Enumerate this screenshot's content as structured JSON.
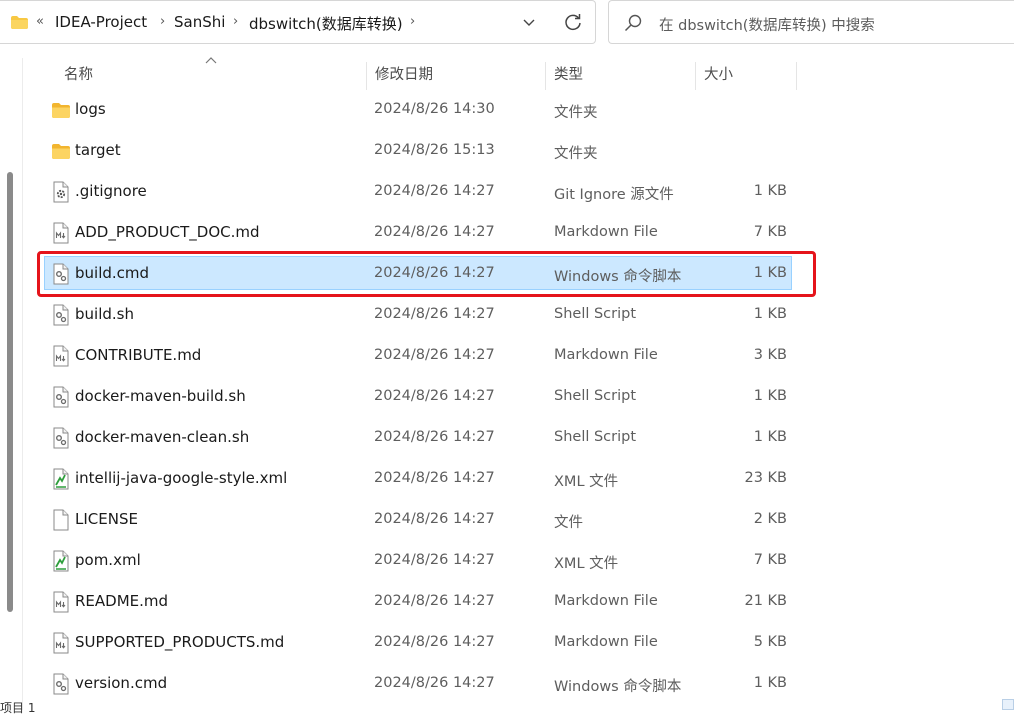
{
  "address": {
    "breadcrumb": [
      "IDEA-Project",
      "SanShi",
      "dbswitch(数据库转换)"
    ],
    "overflow_glyph": "«",
    "separator_glyph": "›"
  },
  "search": {
    "placeholder": "在 dbswitch(数据库转换) 中搜索"
  },
  "columns": {
    "name": "名称",
    "date": "修改日期",
    "type": "类型",
    "size": "大小"
  },
  "files": [
    {
      "name": "logs",
      "date": "2024/8/26 14:30",
      "type": "文件夹",
      "size": "",
      "icon": "folder-icon"
    },
    {
      "name": "target",
      "date": "2024/8/26 15:13",
      "type": "文件夹",
      "size": "",
      "icon": "folder-icon"
    },
    {
      "name": ".gitignore",
      "date": "2024/8/26 14:27",
      "type": "Git Ignore 源文件",
      "size": "1 KB",
      "icon": "settings-file-icon"
    },
    {
      "name": "ADD_PRODUCT_DOC.md",
      "date": "2024/8/26 14:27",
      "type": "Markdown File",
      "size": "7 KB",
      "icon": "markdown-file-icon"
    },
    {
      "name": "build.cmd",
      "date": "2024/8/26 14:27",
      "type": "Windows 命令脚本",
      "size": "1 KB",
      "icon": "script-file-icon",
      "selected": true
    },
    {
      "name": "build.sh",
      "date": "2024/8/26 14:27",
      "type": "Shell Script",
      "size": "1 KB",
      "icon": "script-file-icon"
    },
    {
      "name": "CONTRIBUTE.md",
      "date": "2024/8/26 14:27",
      "type": "Markdown File",
      "size": "3 KB",
      "icon": "markdown-file-icon"
    },
    {
      "name": "docker-maven-build.sh",
      "date": "2024/8/26 14:27",
      "type": "Shell Script",
      "size": "1 KB",
      "icon": "script-file-icon"
    },
    {
      "name": "docker-maven-clean.sh",
      "date": "2024/8/26 14:27",
      "type": "Shell Script",
      "size": "1 KB",
      "icon": "script-file-icon"
    },
    {
      "name": "intellij-java-google-style.xml",
      "date": "2024/8/26 14:27",
      "type": "XML 文件",
      "size": "23 KB",
      "icon": "xml-file-icon"
    },
    {
      "name": "LICENSE",
      "date": "2024/8/26 14:27",
      "type": "文件",
      "size": "2 KB",
      "icon": "blank-file-icon"
    },
    {
      "name": "pom.xml",
      "date": "2024/8/26 14:27",
      "type": "XML 文件",
      "size": "7 KB",
      "icon": "xml-file-icon"
    },
    {
      "name": "README.md",
      "date": "2024/8/26 14:27",
      "type": "Markdown File",
      "size": "21 KB",
      "icon": "markdown-file-icon"
    },
    {
      "name": "SUPPORTED_PRODUCTS.md",
      "date": "2024/8/26 14:27",
      "type": "Markdown File",
      "size": "5 KB",
      "icon": "markdown-file-icon"
    },
    {
      "name": "version.cmd",
      "date": "2024/8/26 14:27",
      "type": "Windows 命令脚本",
      "size": "1 KB",
      "icon": "script-file-icon"
    }
  ],
  "status": {
    "partial_text": "项目 1"
  },
  "colors": {
    "selection_bg": "#cce8ff",
    "selection_border": "#99d1ff",
    "annotation_red": "#e5141b",
    "folder_yellow": "#f8c843"
  }
}
